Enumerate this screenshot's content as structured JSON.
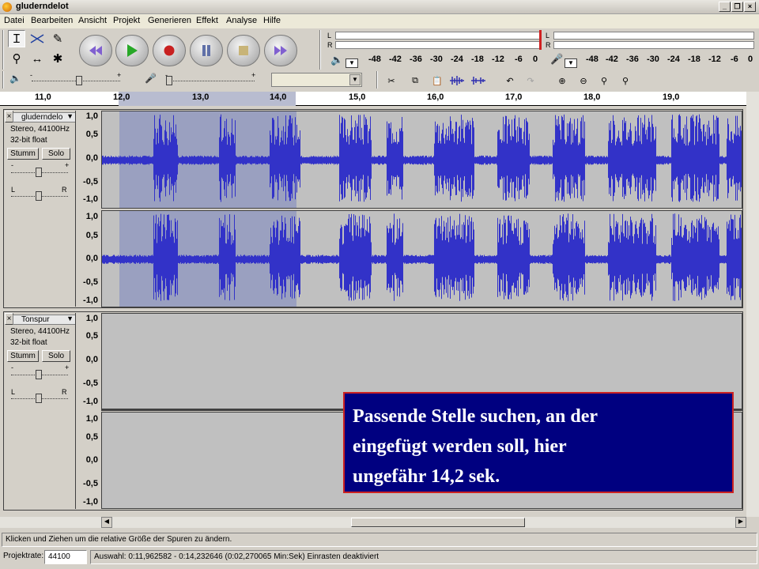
{
  "window": {
    "title": "gluderndelot"
  },
  "menu": [
    "Datei",
    "Bearbeiten",
    "Ansicht",
    "Projekt",
    "Generieren",
    "Effekt",
    "Analyse",
    "Hilfe"
  ],
  "meters": {
    "play_scale": [
      "-48",
      "-42",
      "-36",
      "-30",
      "-24",
      "-18",
      "-12",
      "-6",
      "0"
    ],
    "rec_scale": [
      "-48",
      "-42",
      "-36",
      "-30",
      "-24",
      "-18",
      "-12",
      "-6",
      "0"
    ],
    "left_label": "L",
    "right_label": "R"
  },
  "mixer": {
    "minus": "-",
    "plus": "+"
  },
  "ruler": {
    "labels": [
      "11,0",
      "12,0",
      "13,0",
      "14,0",
      "15,0",
      "16,0",
      "17,0",
      "18,0",
      "19,0"
    ]
  },
  "tracks": [
    {
      "name": "gluderndelo",
      "format": "Stereo, 44100Hz",
      "bitdepth": "32-bit float",
      "mute_label": "Stumm",
      "solo_label": "Solo",
      "gain_minus": "-",
      "gain_plus": "+",
      "pan_left": "L",
      "pan_right": "R",
      "scale": [
        "1,0",
        "0,5",
        "0,0",
        "-0,5",
        "-1,0"
      ]
    },
    {
      "name": "Tonspur",
      "format": "Stereo, 44100Hz",
      "bitdepth": "32-bit float",
      "mute_label": "Stumm",
      "solo_label": "Solo",
      "gain_minus": "-",
      "gain_plus": "+",
      "pan_left": "L",
      "pan_right": "R",
      "scale": [
        "1,0",
        "0,5",
        "0,0",
        "-0,5",
        "-1,0"
      ]
    }
  ],
  "callout": {
    "text_line1": "Passende Stelle suchen, an der",
    "text_line2": "eingefügt werden soll, hier",
    "text_line3": "ungefähr 14,2 sek."
  },
  "status": {
    "hint": "Klicken und Ziehen um die relative Größe der Spuren zu ändern.",
    "rate_label": "Projektrate:",
    "rate_value": "44100",
    "selection": "Auswahl: 0:11,962582 - 0:14,232646 (0:02,270065 Min:Sek)   Einrasten deaktiviert"
  },
  "colors": {
    "waveform": "#3232c8",
    "selection": "#9aa0c0",
    "callout_bg": "#000080",
    "callout_border": "#cc2222"
  }
}
